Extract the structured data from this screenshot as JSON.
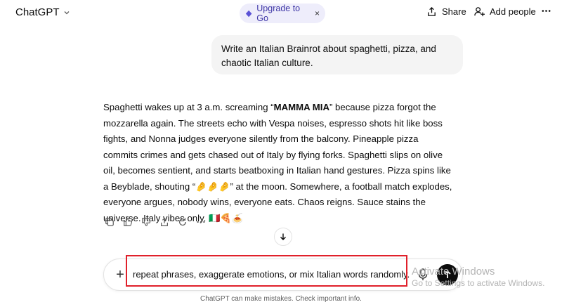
{
  "header": {
    "model_label": "ChatGPT",
    "upgrade_label": "Upgrade to Go",
    "upgrade_close": "×",
    "share_label": "Share",
    "add_people_label": "Add people",
    "more_glyph": "•••"
  },
  "user_message": "Write an Italian Brainrot about spaghetti, pizza, and chaotic Italian culture.",
  "assistant_message": {
    "intro": "Spaghetti wakes up at 3 a.m. screaming “",
    "bold": "MAMMA MIA",
    "rest": "” because pizza forgot the mozzarella again. The streets echo with Vespa noises, espresso shots hit like boss fights, and Nonna judges everyone silently from the balcony. Pineapple pizza commits crimes and gets chased out of Italy by flying forks. Spaghetti slips on olive oil, becomes sentient, and starts beatboxing in Italian hand gestures. Pizza spins like a Beyblade, shouting “🤌🤌🤌” at the moon. Somewhere, a football match explodes, everyone argues, nobody wins, everyone eats. Chaos reigns. Sauce stains the universe. Italy vibes only. 🇮🇹🍕🍝"
  },
  "composer": {
    "plus_glyph": "+",
    "input_value": "repeat phrases, exaggerate emotions, or mix Italian words randomly."
  },
  "watermark": {
    "line1": "Activate Windows",
    "line2": "Go to Settings to activate Windows."
  },
  "disclaimer": "ChatGPT can make mistakes. Check important info.",
  "colors": {
    "upgrade_bg": "#eeedfb",
    "upgrade_text": "#3e36a6",
    "highlight_border": "#e0202a",
    "send_bg": "#0d0d0d"
  }
}
